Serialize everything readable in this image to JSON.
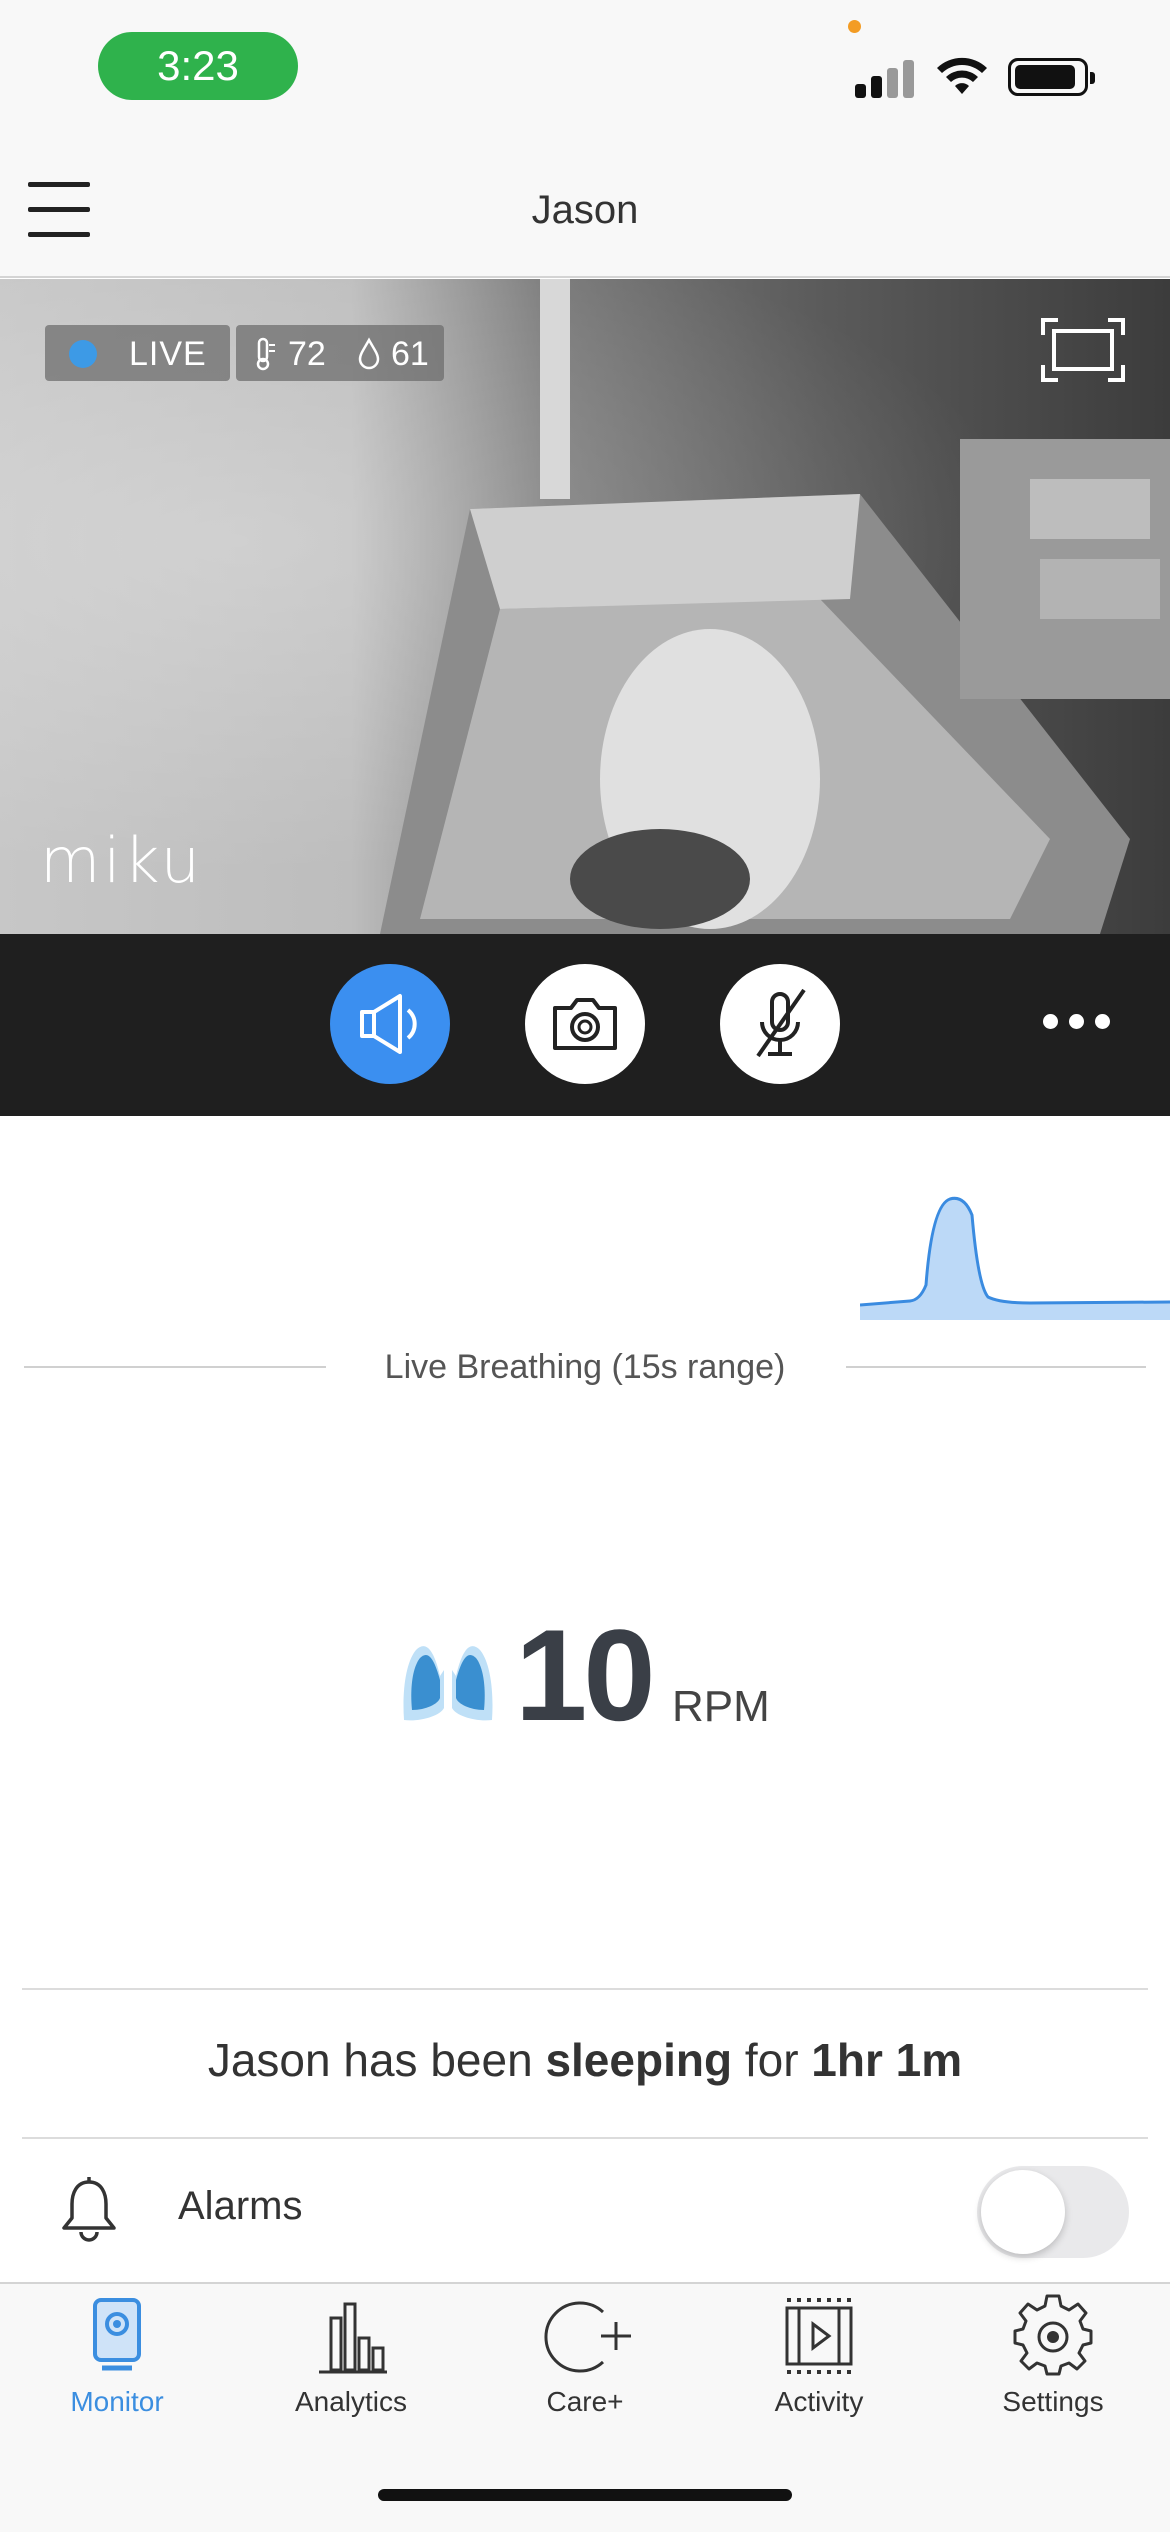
{
  "status_bar": {
    "time": "3:23"
  },
  "header": {
    "title": "Jason"
  },
  "video": {
    "live_label": "LIVE",
    "temperature": "72",
    "humidity": "61",
    "brand": "miku"
  },
  "controls": {
    "speaker_icon": "speaker-icon",
    "camera_icon": "camera-icon",
    "mic_icon": "mic-muted-icon",
    "more_icon": "more-icon",
    "speaker_active": true
  },
  "breathing": {
    "label": "Live Breathing (15s range)",
    "rate": "10",
    "unit": "RPM",
    "wave_color": "#3a8be0"
  },
  "sleep_status": {
    "prefix": "Jason has been ",
    "state": "sleeping",
    "middle": " for ",
    "duration": "1hr 1m"
  },
  "alarms": {
    "label": "Alarms",
    "enabled": false
  },
  "tabbar": {
    "tabs": [
      {
        "label": "Monitor",
        "icon": "monitor-icon",
        "active": true
      },
      {
        "label": "Analytics",
        "icon": "analytics-icon",
        "active": false
      },
      {
        "label": "Care+",
        "icon": "care-plus-icon",
        "active": false
      },
      {
        "label": "Activity",
        "icon": "activity-icon",
        "active": false
      },
      {
        "label": "Settings",
        "icon": "settings-icon",
        "active": false
      }
    ]
  },
  "colors": {
    "accent": "#3b8ee0",
    "time_pill": "#2fb24c",
    "live_dot": "#3d9ae6",
    "controls_bg": "#1f1f1f"
  }
}
